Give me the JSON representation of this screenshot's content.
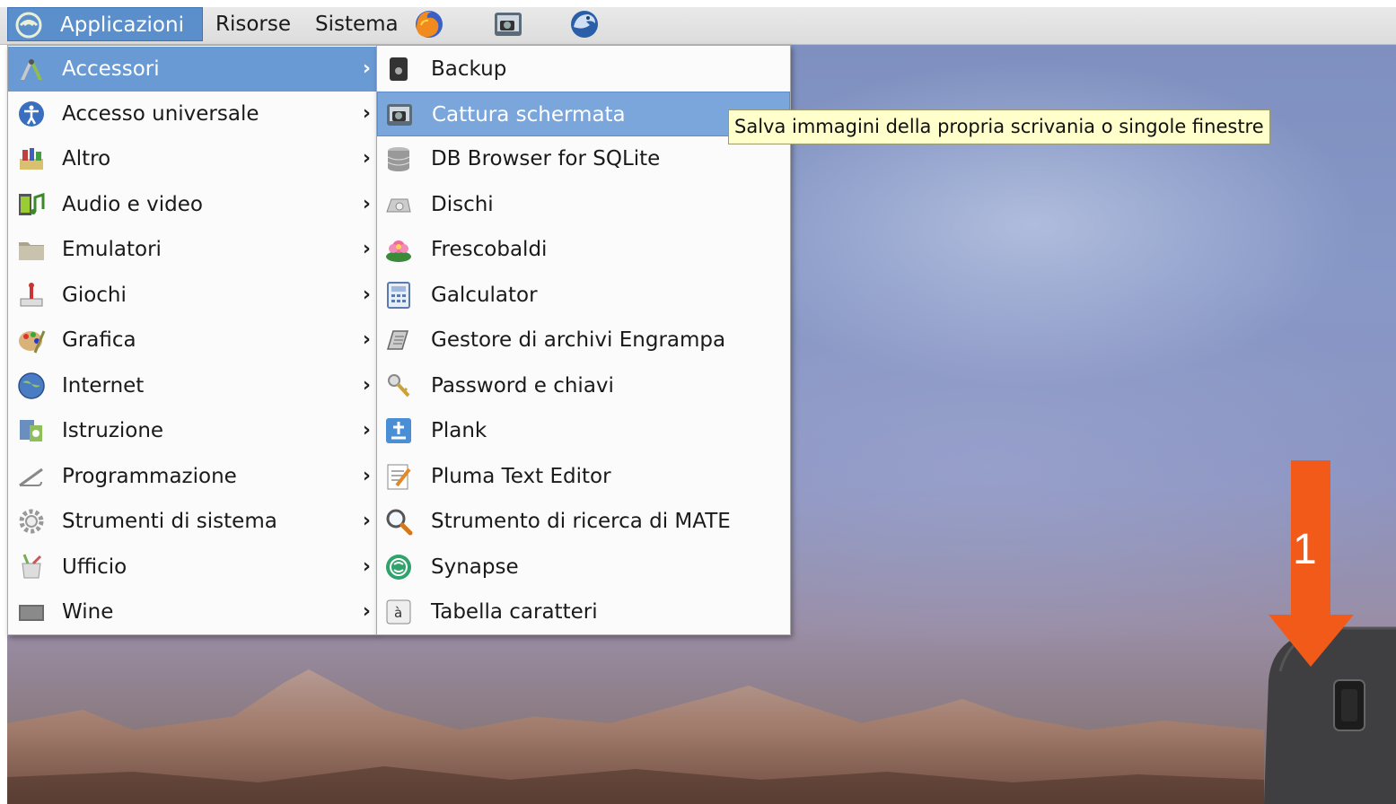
{
  "panel": {
    "applications_label": "Applicazioni",
    "resources_label": "Risorse",
    "system_label": "Sistema",
    "launchers": [
      "firefox-icon",
      "screenshot-icon",
      "thunderbird-icon"
    ]
  },
  "main_menu": {
    "items": [
      {
        "label": "Accessori",
        "icon": "accessories-icon",
        "highlighted": true
      },
      {
        "label": "Accesso universale",
        "icon": "accessibility-icon"
      },
      {
        "label": "Altro",
        "icon": "other-icon"
      },
      {
        "label": "Audio e video",
        "icon": "multimedia-icon"
      },
      {
        "label": "Emulatori",
        "icon": "folder-icon"
      },
      {
        "label": "Giochi",
        "icon": "games-icon"
      },
      {
        "label": "Grafica",
        "icon": "graphics-icon"
      },
      {
        "label": "Internet",
        "icon": "internet-icon"
      },
      {
        "label": "Istruzione",
        "icon": "education-icon"
      },
      {
        "label": "Programmazione",
        "icon": "programming-icon"
      },
      {
        "label": "Strumenti di sistema",
        "icon": "system-tools-icon"
      },
      {
        "label": "Ufficio",
        "icon": "office-icon"
      },
      {
        "label": "Wine",
        "icon": "wine-icon"
      }
    ],
    "arrow": "›"
  },
  "sub_menu": {
    "items": [
      {
        "label": "Backup",
        "icon": "backup-icon"
      },
      {
        "label": "Cattura schermata",
        "icon": "screenshot-icon",
        "highlighted": true
      },
      {
        "label": "DB Browser for SQLite",
        "icon": "database-icon"
      },
      {
        "label": "Dischi",
        "icon": "disks-icon"
      },
      {
        "label": "Frescobaldi",
        "icon": "frescobaldi-icon"
      },
      {
        "label": "Galculator",
        "icon": "calculator-icon"
      },
      {
        "label": "Gestore di archivi Engrampa",
        "icon": "archive-icon"
      },
      {
        "label": "Password e chiavi",
        "icon": "keys-icon"
      },
      {
        "label": "Plank",
        "icon": "plank-icon"
      },
      {
        "label": "Pluma Text Editor",
        "icon": "text-editor-icon"
      },
      {
        "label": "Strumento di ricerca di MATE",
        "icon": "search-icon"
      },
      {
        "label": "Synapse",
        "icon": "synapse-icon"
      },
      {
        "label": "Tabella caratteri",
        "icon": "charmap-icon"
      }
    ]
  },
  "tooltip": "Salva immagini della propria scrivania o singole finestre",
  "annotation": {
    "number": "1",
    "color": "#f25a1a"
  },
  "colors": {
    "highlight": "#6a9ad4",
    "tooltip_bg": "#ffffcc",
    "panel": "#e4e4e4"
  }
}
